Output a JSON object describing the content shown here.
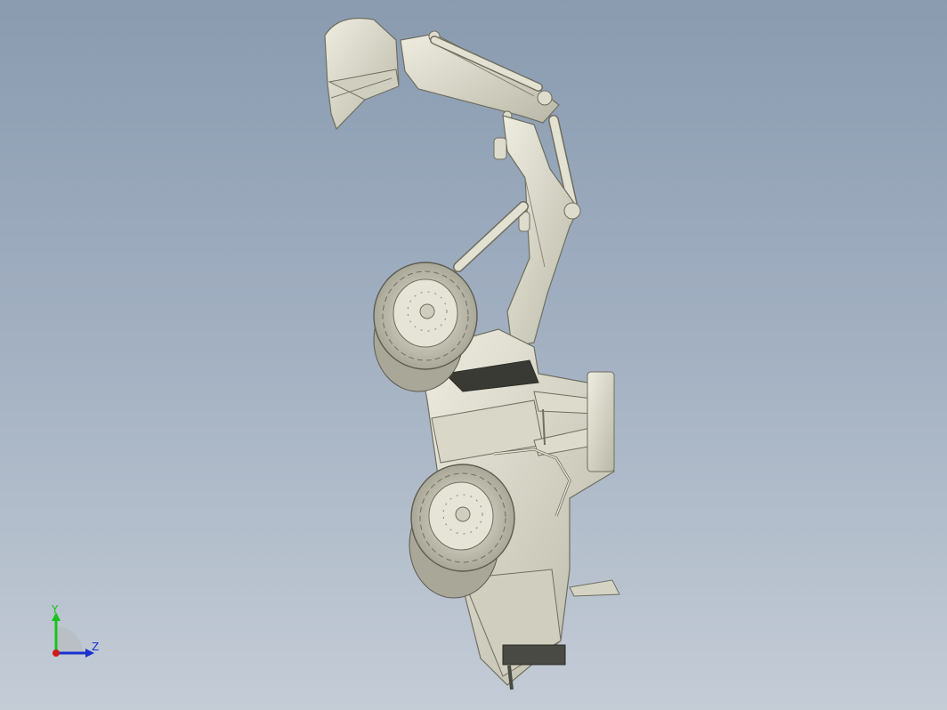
{
  "viewport": {
    "background_top": "#8a9bb0",
    "background_bottom": "#c4ccd6",
    "model": "wheeled-excavator-3d-model"
  },
  "triad": {
    "y_label": "Y",
    "z_label": "Z",
    "y_color": "#19c419",
    "z_color": "#1a2fd0",
    "x_color": "#d01a1a"
  }
}
